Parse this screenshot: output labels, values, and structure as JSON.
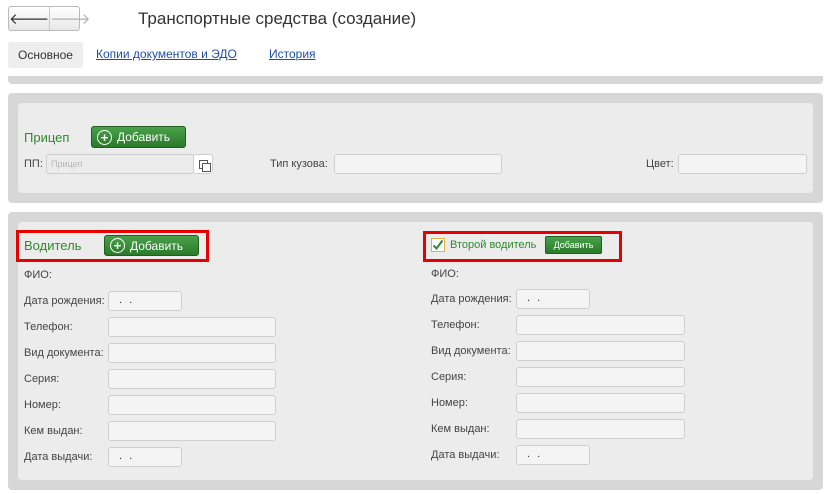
{
  "window": {
    "title": "Транспортные средства (создание)"
  },
  "nav": {
    "back_icon": "arrow-left-icon",
    "forward_icon": "arrow-right-icon"
  },
  "tabs": [
    {
      "label": "Основное",
      "active": true
    },
    {
      "label": "Копии документов и ЭДО",
      "active": false
    },
    {
      "label": "История",
      "active": false
    }
  ],
  "trailer": {
    "title": "Прицеп",
    "add_label": "Добавить",
    "pp_label": "ПП:",
    "pp_placeholder": "Прицеп",
    "body_type_label": "Тип кузова:",
    "body_type_value": "",
    "color_label": "Цвет:",
    "color_value": ""
  },
  "driver": {
    "title": "Водитель",
    "add_label": "Добавить",
    "fio_label": "ФИО:",
    "birth_date_label": "Дата рождения:",
    "birth_date_value": ". .",
    "phone_label": "Телефон:",
    "doc_type_label": "Вид документа:",
    "series_label": "Серия:",
    "number_label": "Номер:",
    "issued_by_label": "Кем выдан:",
    "issue_date_label": "Дата выдачи:",
    "issue_date_value": ". ."
  },
  "second_driver": {
    "title": "Второй водитель",
    "checked": true,
    "add_label": "Добавить",
    "fio_label": "ФИО:",
    "birth_date_label": "Дата рождения:",
    "birth_date_value": ". .",
    "phone_label": "Телефон:",
    "doc_type_label": "Вид документа:",
    "series_label": "Серия:",
    "number_label": "Номер:",
    "issued_by_label": "Кем выдан:",
    "issue_date_label": "Дата выдачи:",
    "issue_date_value": ". ."
  },
  "colors": {
    "accent_green": "#2d8a2d",
    "link_blue": "#1e4fa1",
    "highlight_red": "#e60000"
  }
}
